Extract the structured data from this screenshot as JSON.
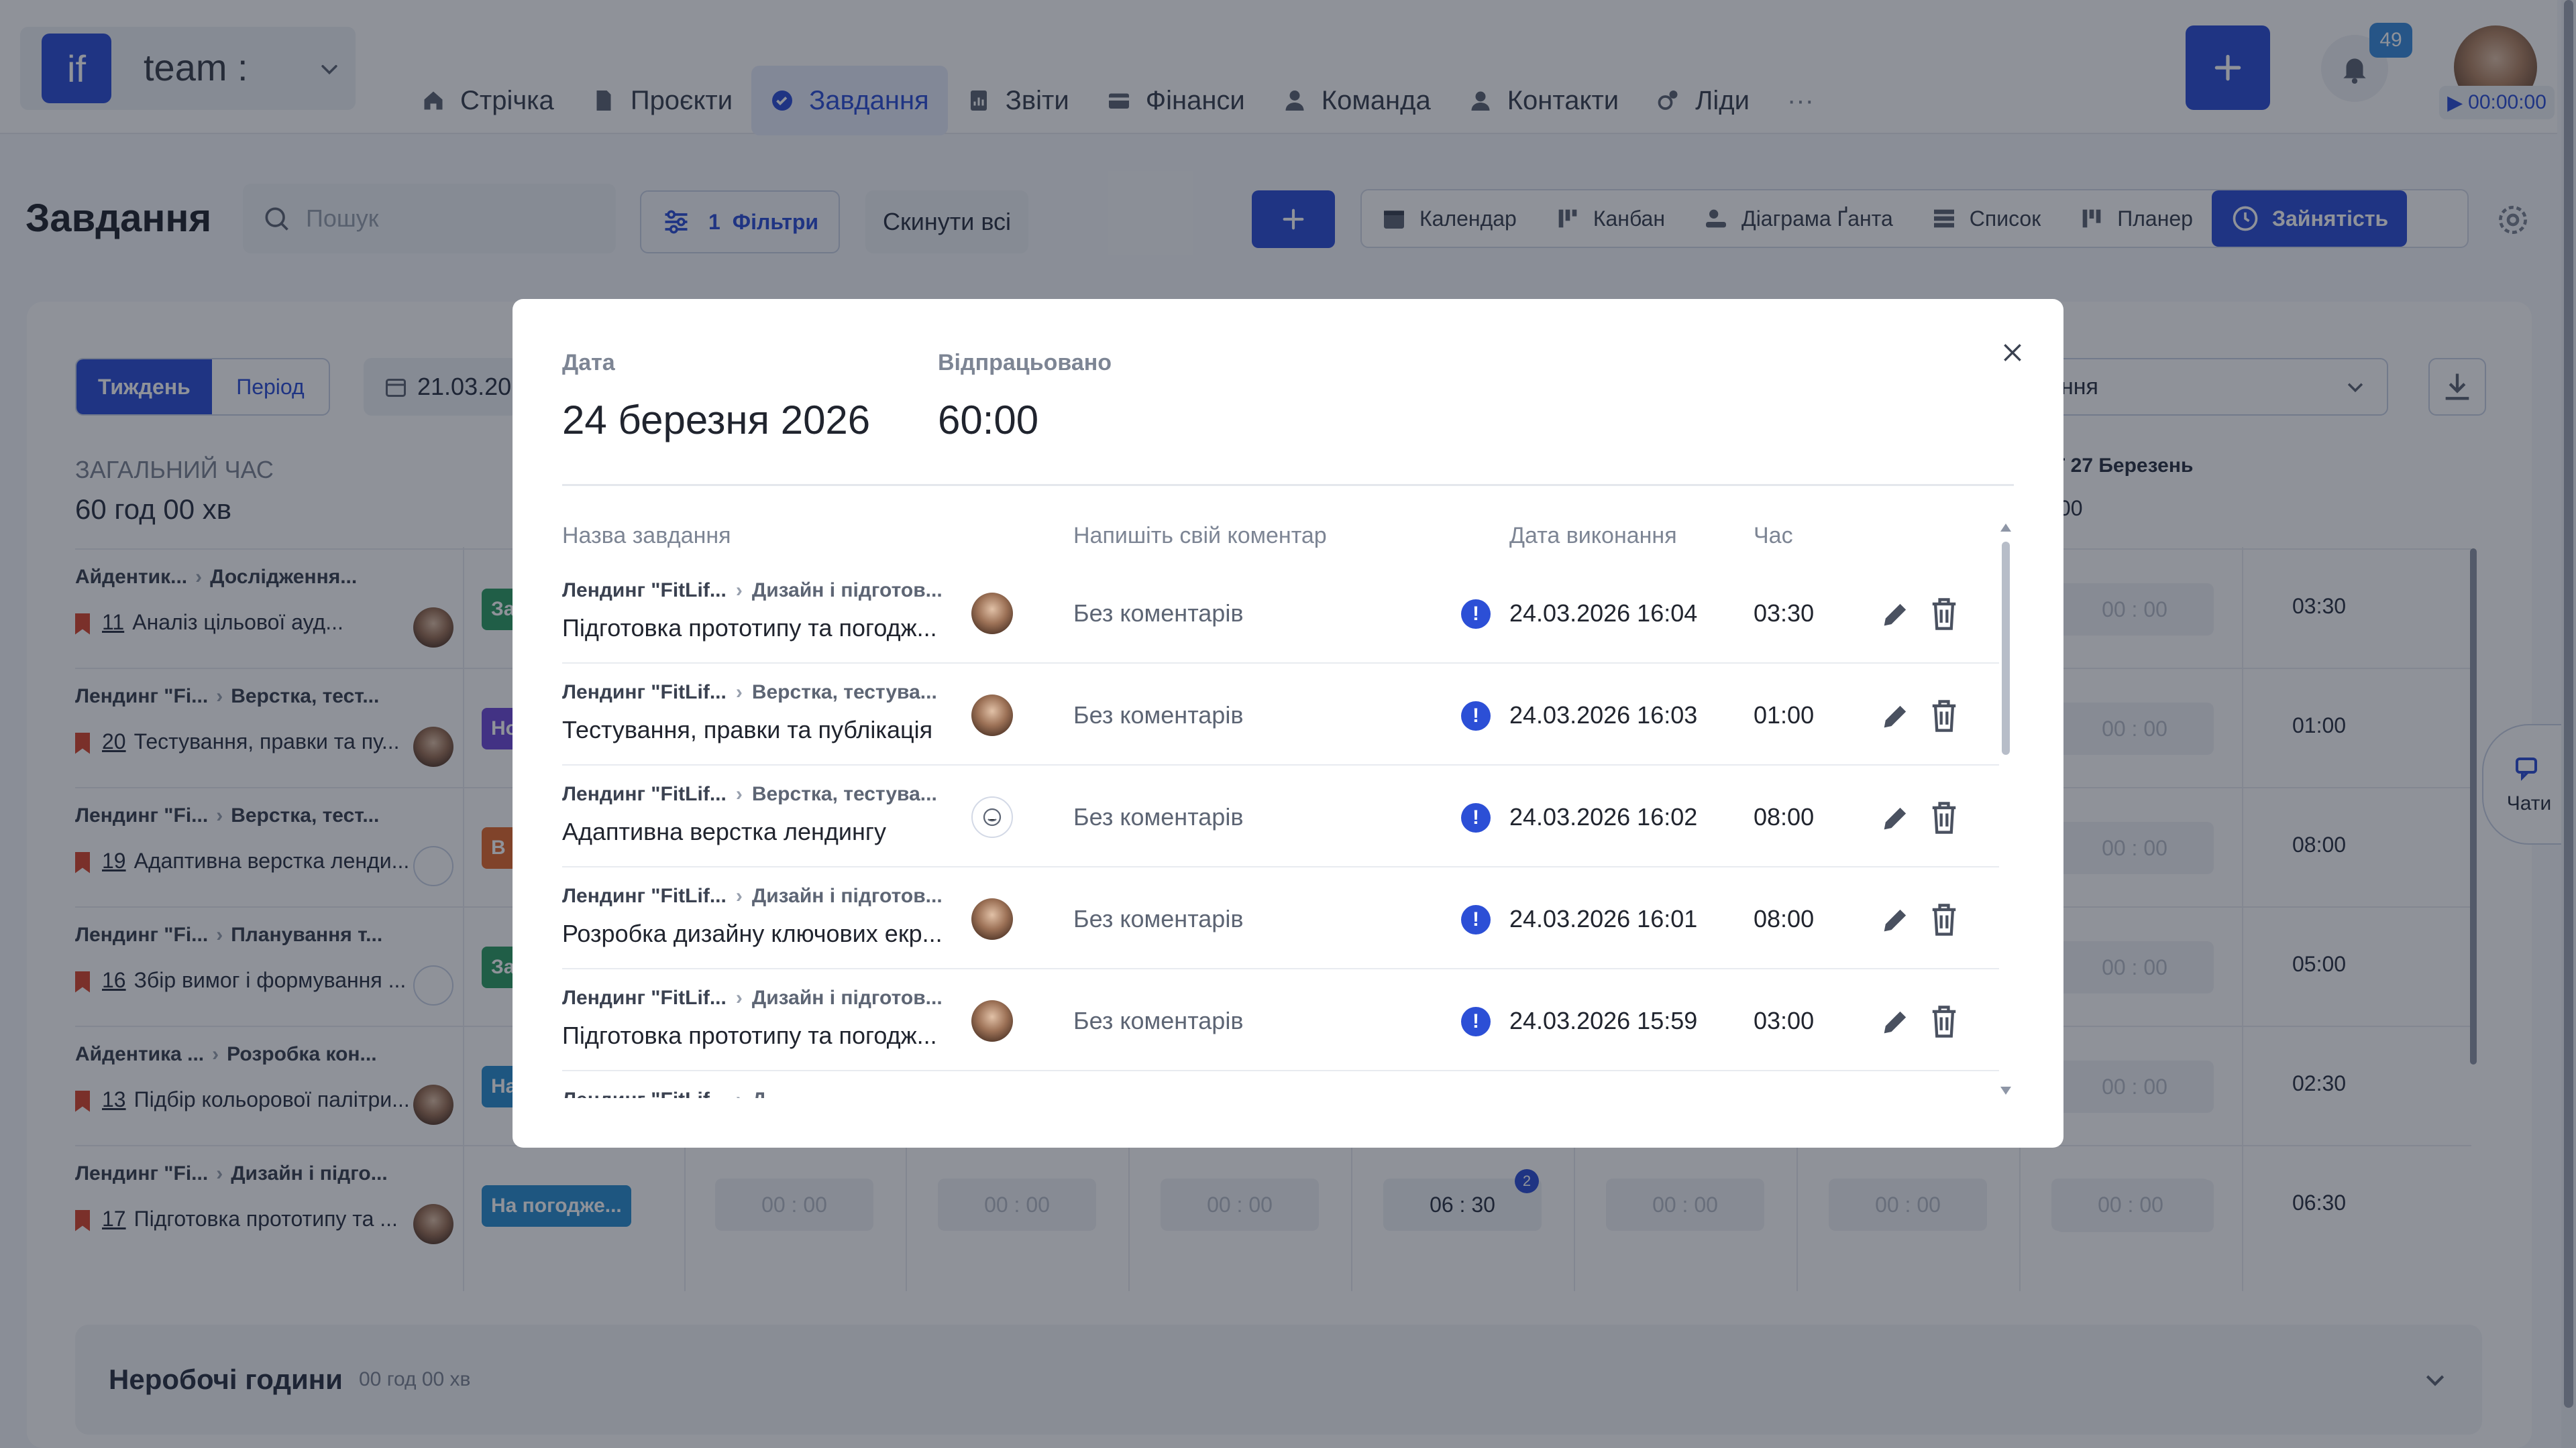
{
  "workspace": {
    "logo": "if",
    "name": "team :"
  },
  "nav": [
    {
      "label": "Стрічка",
      "icon": "home-icon"
    },
    {
      "label": "Проєкти",
      "icon": "document-icon"
    },
    {
      "label": "Завдання",
      "icon": "check-circle-icon",
      "active": true
    },
    {
      "label": "Звіти",
      "icon": "report-icon"
    },
    {
      "label": "Фінанси",
      "icon": "wallet-icon"
    },
    {
      "label": "Команда",
      "icon": "user-icon"
    },
    {
      "label": "Контакти",
      "icon": "contacts-icon"
    },
    {
      "label": "Ліди",
      "icon": "leads-icon"
    },
    {
      "label": "···",
      "icon": "more-icon"
    }
  ],
  "header": {
    "notifications": "49",
    "timer": "00:00:00"
  },
  "page": {
    "title": "Завдання",
    "search_placeholder": "Пошук",
    "filter_count": "1",
    "filters_label": "Фільтри",
    "reset_label": "Скинути всі"
  },
  "views": [
    {
      "label": "Календар",
      "icon": "calendar-icon"
    },
    {
      "label": "Канбан",
      "icon": "kanban-icon"
    },
    {
      "label": "Діаграма Ґанта",
      "icon": "gantt-icon"
    },
    {
      "label": "Список",
      "icon": "list-icon"
    },
    {
      "label": "Планер",
      "icon": "planner-icon"
    },
    {
      "label": "Зайнятість",
      "icon": "clock-icon",
      "active": true
    }
  ],
  "workload": {
    "toggle": {
      "week": "Тиждень",
      "period": "Період"
    },
    "date": "21.03.20",
    "select_text": "ння",
    "total_label": "ЗАГАЛЬНИЙ ЧАС",
    "total_value": "60 год 00 хв",
    "col_day": "Т 27 Березень",
    "col_time": ":00",
    "rows": [
      {
        "project": "Айдентик...",
        "stage": "Дослідження...",
        "num": "11",
        "title": "Аналіз цільової ауд...",
        "status": "За",
        "status_color": "#2f9e64",
        "cells": [
          "00 : 00",
          "03:30"
        ]
      },
      {
        "project": "Лендинг \"Fi...",
        "stage": "Верстка, тест...",
        "num": "20",
        "title": "Тестування, правки та пу...",
        "status": "Но",
        "status_color": "#6f4bd8",
        "cells": [
          "00 : 00",
          "01:00"
        ]
      },
      {
        "project": "Лендинг \"Fi...",
        "stage": "Верстка, тест...",
        "num": "19",
        "title": "Адаптивна верстка ленди...",
        "status": "В р",
        "status_color": "#e36a2f",
        "cells": [
          "00 : 00",
          "08:00"
        ]
      },
      {
        "project": "Лендинг \"Fi...",
        "stage": "Планування т...",
        "num": "16",
        "title": "Збір вимог і формування ...",
        "status": "За",
        "status_color": "#2f9e64",
        "cells": [
          "00 : 00",
          "05:00"
        ]
      },
      {
        "project": "Айдентика ...",
        "stage": "Розробка кон...",
        "num": "13",
        "title": "Підбір кольорової палітри...",
        "status": "На",
        "status_color": "#2a8fd0",
        "cells": [
          "00 : 00",
          "02:30"
        ]
      },
      {
        "project": "Лендинг \"Fi...",
        "stage": "Дизайн і підго...",
        "num": "17",
        "title": "Підготовка прототипу та ...",
        "status": "На погодже...",
        "status_color": "#2a8fd0",
        "cells": [
          "00 : 00",
          "06:30"
        ]
      }
    ],
    "last_row_cells": [
      "00 : 00",
      "00 : 00",
      "00 : 00",
      "06 : 30",
      "00 : 00",
      "00 : 00",
      "00 : 00"
    ],
    "comments_badge": "2",
    "nonwork_label": "Неробочі години",
    "nonwork_value": "00 год 00 хв"
  },
  "chats_label": "Чати",
  "modal": {
    "date_label": "Дата",
    "date_value": "24 березня 2026",
    "worked_label": "Відпрацьовано",
    "worked_value": "60:00",
    "headers": {
      "task": "Назва завдання",
      "comment": "Напишіть свій коментар",
      "due": "Дата виконання",
      "time": "Час"
    },
    "rows": [
      {
        "project": "Лендинг \"FitLif...",
        "stage": "Дизайн і підготов...",
        "task": "Підготовка прототипу та погодж...",
        "assignee": "avatar",
        "comment": "Без коментарів",
        "date": "24.03.2026 16:04",
        "time": "03:30"
      },
      {
        "project": "Лендинг \"FitLif...",
        "stage": "Верстка, тестува...",
        "task": "Тестування, правки та публікація",
        "assignee": "avatar",
        "comment": "Без коментарів",
        "date": "24.03.2026 16:03",
        "time": "01:00"
      },
      {
        "project": "Лендинг \"FitLif...",
        "stage": "Верстка, тестува...",
        "task": "Адаптивна верстка лендингу",
        "assignee": "placeholder",
        "comment": "Без коментарів",
        "date": "24.03.2026 16:02",
        "time": "08:00"
      },
      {
        "project": "Лендинг \"FitLif...",
        "stage": "Дизайн і підготов...",
        "task": "Розробка дизайну ключових екр...",
        "assignee": "avatar",
        "comment": "Без коментарів",
        "date": "24.03.2026 16:01",
        "time": "08:00"
      },
      {
        "project": "Лендинг \"FitLif...",
        "stage": "Дизайн і підготов...",
        "task": "Підготовка прототипу та погодж...",
        "assignee": "avatar",
        "comment": "Без коментарів",
        "date": "24.03.2026 15:59",
        "time": "03:00"
      },
      {
        "project": "Лендинг \"FitLif...",
        "stage": "Д...",
        "task": "",
        "assignee": "avatar",
        "comment": "",
        "date": "",
        "time": ""
      }
    ]
  },
  "colors": {
    "accent": "#2c4fd6",
    "alert": "#2c4fd6"
  }
}
